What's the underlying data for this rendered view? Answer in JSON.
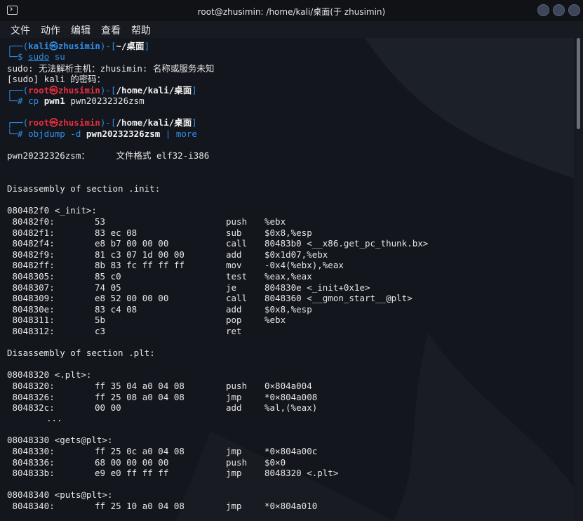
{
  "window": {
    "title": "root@zhusimin: /home/kali/桌面(于 zhusimin)"
  },
  "menu": [
    "文件",
    "动作",
    "编辑",
    "查看",
    "帮助"
  ],
  "prompt1": {
    "open": "┌──(",
    "user": "kali㉿zhusimin",
    "mid": ")-[",
    "path": "~/桌面",
    "close": "]",
    "arrow": "└─$ ",
    "cmd": "sudo",
    "arg": " su"
  },
  "msg1": "sudo: 无法解析主机：zhusimin: 名称或服务未知",
  "msg2": "[sudo] kali 的密码：",
  "prompt2": {
    "open": "┌──(",
    "user": "root㉿zhusimin",
    "mid": ")-[",
    "path": "/home/kali/桌面",
    "close": "]",
    "arrow": "└─# ",
    "cmd": "cp ",
    "arg_bold": "pwn1",
    "arg_rest": " pwn20232326zsm"
  },
  "prompt3": {
    "open": "┌──(",
    "user": "root㉿zhusimin",
    "mid": ")-[",
    "path": "/home/kali/桌面",
    "close": "]",
    "arrow": "└─# ",
    "cmd": "objdump -d ",
    "arg_bold": "pwn20232326zsm",
    "pipe": " | ",
    "more": "more"
  },
  "file_format_line": "pwn20232326zsm：     文件格式 elf32-i386",
  "sections": {
    "init_header": "Disassembly of section .init:",
    "init_label": "080482f0 <_init>:",
    "plt_header": "Disassembly of section .plt:",
    "plt_label": "08048320 <.plt>:",
    "ellipsis": "...",
    "gets_label": "08048330 <gets@plt>:",
    "puts_label": "08048340 <puts@plt>:"
  },
  "asm": {
    "init": [
      {
        "addr": " 80482f0:",
        "bytes": "53",
        "op": "push",
        "args": "%ebx"
      },
      {
        "addr": " 80482f1:",
        "bytes": "83 ec 08",
        "op": "sub",
        "args": "$0x8,%esp"
      },
      {
        "addr": " 80482f4:",
        "bytes": "e8 b7 00 00 00",
        "op": "call",
        "args": "80483b0 <__x86.get_pc_thunk.bx>"
      },
      {
        "addr": " 80482f9:",
        "bytes": "81 c3 07 1d 00 00",
        "op": "add",
        "args": "$0x1d07,%ebx"
      },
      {
        "addr": " 80482ff:",
        "bytes": "8b 83 fc ff ff ff",
        "op": "mov",
        "args": "-0x4(%ebx),%eax"
      },
      {
        "addr": " 8048305:",
        "bytes": "85 c0",
        "op": "test",
        "args": "%eax,%eax"
      },
      {
        "addr": " 8048307:",
        "bytes": "74 05",
        "op": "je",
        "args": "804830e <_init+0x1e>"
      },
      {
        "addr": " 8048309:",
        "bytes": "e8 52 00 00 00",
        "op": "call",
        "args": "8048360 <__gmon_start__@plt>"
      },
      {
        "addr": " 804830e:",
        "bytes": "83 c4 08",
        "op": "add",
        "args": "$0x8,%esp"
      },
      {
        "addr": " 8048311:",
        "bytes": "5b",
        "op": "pop",
        "args": "%ebx"
      },
      {
        "addr": " 8048312:",
        "bytes": "c3",
        "op": "ret",
        "args": ""
      }
    ],
    "plt": [
      {
        "addr": " 8048320:",
        "bytes": "ff 35 04 a0 04 08",
        "op": "push",
        "args": "0×804a004"
      },
      {
        "addr": " 8048326:",
        "bytes": "ff 25 08 a0 04 08",
        "op": "jmp",
        "args": "*0×804a008"
      },
      {
        "addr": " 804832c:",
        "bytes": "00 00",
        "op": "add",
        "args": "%al,(%eax)"
      }
    ],
    "gets": [
      {
        "addr": " 8048330:",
        "bytes": "ff 25 0c a0 04 08",
        "op": "jmp",
        "args": "*0×804a00c"
      },
      {
        "addr": " 8048336:",
        "bytes": "68 00 00 00 00",
        "op": "push",
        "args": "$0×0"
      },
      {
        "addr": " 804833b:",
        "bytes": "e9 e0 ff ff ff",
        "op": "jmp",
        "args": "8048320 <.plt>"
      }
    ],
    "puts": [
      {
        "addr": " 8048340:",
        "bytes": "ff 25 10 a0 04 08",
        "op": "jmp",
        "args": "*0×804a010"
      }
    ]
  },
  "colors": {
    "prompt_blue": "#2f8ee6",
    "root_red": "#ea2e3e",
    "text": "#e6e6e6",
    "background": "#13161c"
  },
  "icons": {
    "app": "terminal-icon",
    "minimize": "minimize-icon",
    "maximize": "maximize-icon",
    "close": "close-icon"
  }
}
